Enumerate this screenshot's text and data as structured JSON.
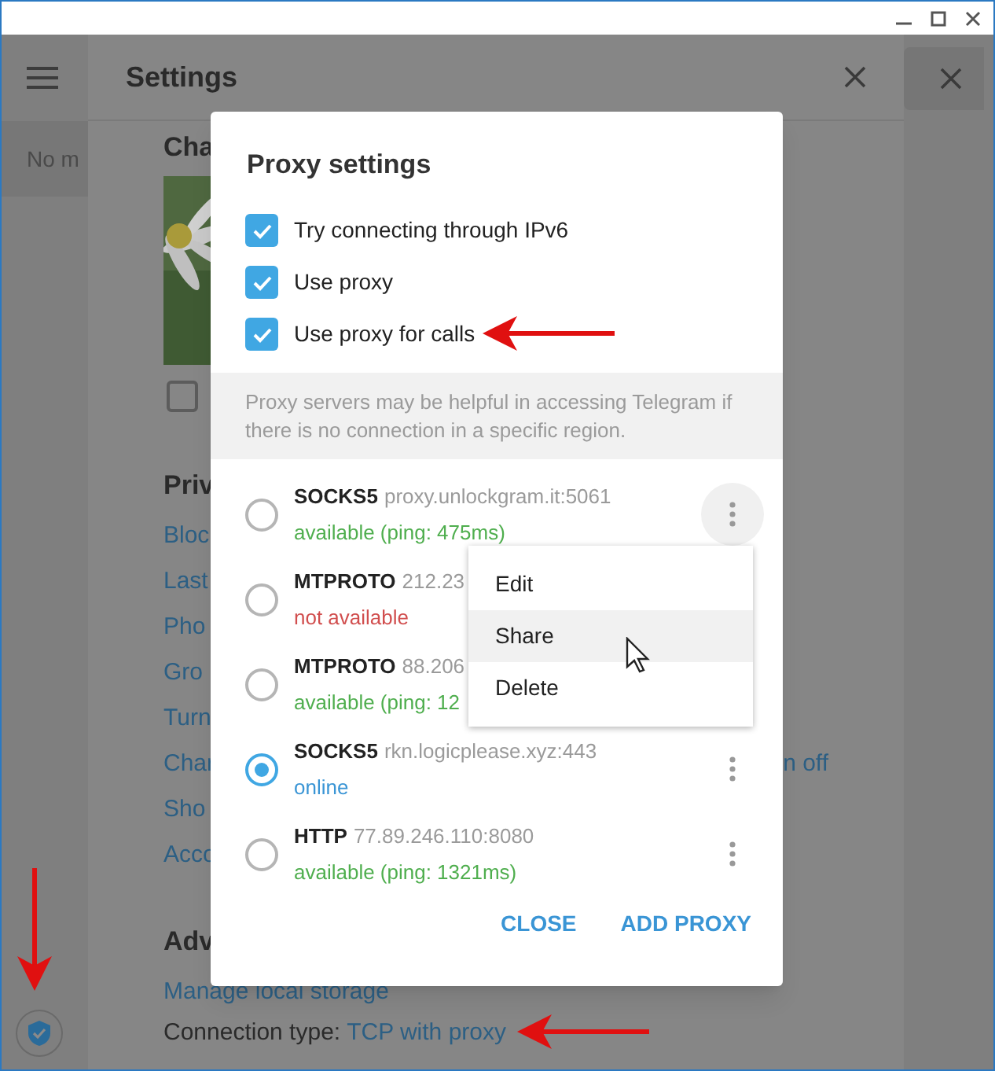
{
  "sidebar": {
    "status_text": "No m"
  },
  "settings": {
    "title": "Settings",
    "chat_heading": "Cha",
    "photo_checkbox": {
      "checked": false
    },
    "privacy_heading": "Priv",
    "privacy_links": [
      {
        "label": "Bloc"
      },
      {
        "label": "Last"
      },
      {
        "label": "Pho"
      },
      {
        "label": "Gro"
      },
      {
        "label": "Turn"
      },
      {
        "label": "Char",
        "value": "n off"
      },
      {
        "label": "Sho"
      },
      {
        "label": "Acco"
      }
    ],
    "advanced_heading": "Adv",
    "storage_link": "Manage local storage",
    "connection_label": "Connection type:",
    "connection_value": "TCP with proxy"
  },
  "proxy_dialog": {
    "title": "Proxy settings",
    "options": [
      {
        "label": "Try connecting through IPv6",
        "checked": true
      },
      {
        "label": "Use proxy",
        "checked": true
      },
      {
        "label": "Use proxy for calls",
        "checked": true
      }
    ],
    "note": "Proxy servers may be helpful in accessing Telegram if there is no connection in a specific region.",
    "proxies": [
      {
        "type": "SOCKS5",
        "address": "proxy.unlockgram.it:5061",
        "status": "available (ping: 475ms)",
        "color": "#4fae4e",
        "selected": false,
        "hovered": true
      },
      {
        "type": "MTPROTO",
        "address": "212.23",
        "status": "not available",
        "color": "#d14e4e",
        "selected": false
      },
      {
        "type": "MTPROTO",
        "address": "88.206",
        "status": "available (ping: 12",
        "color": "#4fae4e",
        "selected": false
      },
      {
        "type": "SOCKS5",
        "address": "rkn.logicplease.xyz:443",
        "status": "online",
        "color": "#3a95d5",
        "selected": true,
        "hovered": false
      },
      {
        "type": "HTTP",
        "address": "77.89.246.110:8080",
        "status": "available (ping: 1321ms)",
        "color": "#4fae4e",
        "selected": false,
        "hovered": false
      }
    ],
    "menu": {
      "items": [
        {
          "label": "Edit",
          "selected": false
        },
        {
          "label": "Share",
          "selected": true
        },
        {
          "label": "Delete",
          "selected": false
        }
      ]
    },
    "buttons": [
      "CLOSE",
      "ADD PROXY"
    ]
  }
}
